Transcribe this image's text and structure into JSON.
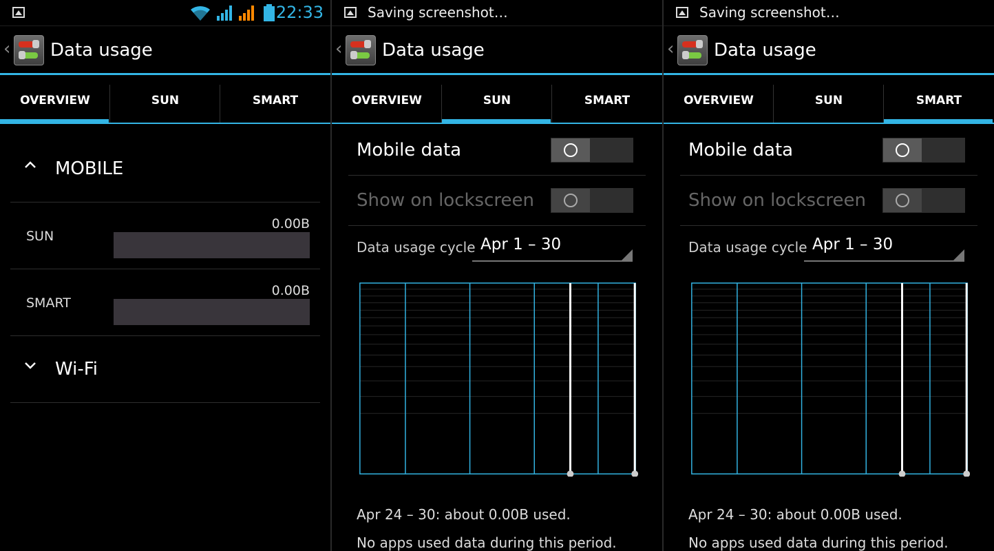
{
  "status_bar": {
    "panel1_time": "22:33",
    "notification_text": "Saving screenshot…",
    "accent": "#33b5e5",
    "icons": [
      "image-icon",
      "wifi-icon",
      "signal-icon",
      "signal-orange-icon",
      "battery-icon"
    ]
  },
  "action_bar": {
    "title": "Data usage"
  },
  "tabs": [
    {
      "label": "OVERVIEW"
    },
    {
      "label": "SUN"
    },
    {
      "label": "SMART"
    }
  ],
  "overview": {
    "mobile_header": "MOBILE",
    "rows": [
      {
        "name": "SUN",
        "amount": "0.00B"
      },
      {
        "name": "SMART",
        "amount": "0.00B"
      }
    ],
    "wifi_header": "Wi-Fi"
  },
  "sim": {
    "mobile_data_label": "Mobile data",
    "lockscreen_label": "Show on lockscreen",
    "cycle_label": "Data usage cycle",
    "cycle_value": "Apr 1 – 30",
    "summary": "Apr 24 – 30: about 0.00B used.",
    "no_apps": "No apps used data during this period."
  }
}
